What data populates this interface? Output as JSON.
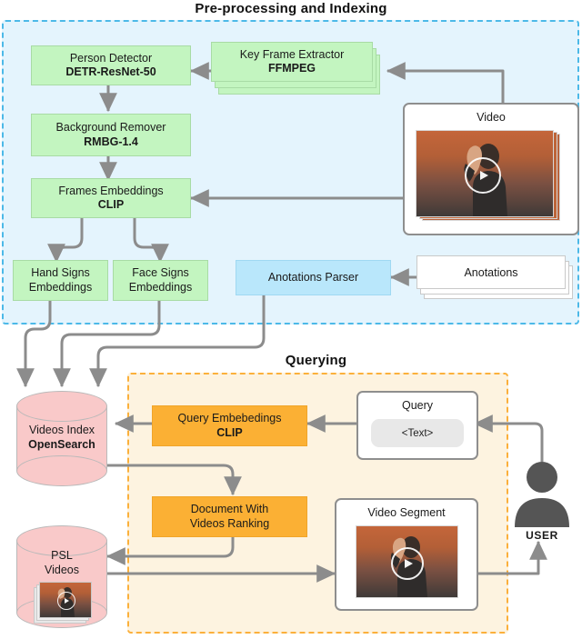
{
  "diagram": {
    "sections": {
      "preprocessing": {
        "title": "Pre-processing and Indexing",
        "accent": "#4cb9e8",
        "fill": "#e4f4fd"
      },
      "querying": {
        "title": "Querying",
        "accent": "#fbb03b",
        "fill": "#fdf3e0"
      }
    },
    "nodes": {
      "person_detector": {
        "title": "Person Detector",
        "model": "DETR-ResNet-50",
        "color": "#c3f5c0"
      },
      "key_frame": {
        "title": "Key Frame Extractor",
        "model": "FFMPEG",
        "color": "#c3f5c0"
      },
      "background_remover": {
        "title": "Background Remover",
        "model": "RMBG-1.4",
        "color": "#c3f5c0"
      },
      "frames_embeddings": {
        "title": "Frames Embeddings",
        "model": "CLIP",
        "color": "#c3f5c0"
      },
      "hand_signs": {
        "line1": "Hand Signs",
        "line2": "Embeddings",
        "color": "#c3f5c0"
      },
      "face_signs": {
        "line1": "Face Signs",
        "line2": "Embeddings",
        "color": "#c3f5c0"
      },
      "anotations_parser": {
        "title": "Anotations Parser",
        "color": "#b9e7fb"
      },
      "anotations": {
        "title": "Anotations",
        "color": "#ffffff"
      },
      "video": {
        "title": "Video",
        "color": "#ffffff"
      },
      "videos_index": {
        "line1": "Videos Index",
        "line2": "OpenSearch",
        "color": "#f9c9c9"
      },
      "psl_videos": {
        "line1": "PSL",
        "line2": "Videos",
        "color": "#f9c9c9"
      },
      "query_embeddings": {
        "title": "Query Embebedings",
        "model": "CLIP",
        "color": "#fbb034"
      },
      "document_ranking": {
        "line1": "Document With",
        "line2": "Videos Ranking",
        "color": "#fbb034"
      },
      "query": {
        "title": "Query",
        "value": "<Text>",
        "color": "#ffffff"
      },
      "video_segment": {
        "title": "Video Segment",
        "color": "#ffffff"
      },
      "user": {
        "label": "USER",
        "color": "#555555"
      }
    },
    "icons": {
      "play": "play-icon",
      "user": "user-icon",
      "database": "database-cylinder-icon"
    },
    "edges": [
      {
        "from": "video",
        "to": "key_frame"
      },
      {
        "from": "key_frame",
        "to": "person_detector"
      },
      {
        "from": "person_detector",
        "to": "background_remover"
      },
      {
        "from": "background_remover",
        "to": "frames_embeddings"
      },
      {
        "from": "video",
        "to": "frames_embeddings"
      },
      {
        "from": "frames_embeddings",
        "to": "hand_signs"
      },
      {
        "from": "frames_embeddings",
        "to": "face_signs"
      },
      {
        "from": "anotations",
        "to": "anotations_parser"
      },
      {
        "from": "hand_signs",
        "to": "videos_index"
      },
      {
        "from": "face_signs",
        "to": "videos_index"
      },
      {
        "from": "anotations_parser",
        "to": "videos_index"
      },
      {
        "from": "user",
        "to": "query"
      },
      {
        "from": "query",
        "to": "query_embeddings"
      },
      {
        "from": "query_embeddings",
        "to": "videos_index"
      },
      {
        "from": "videos_index",
        "to": "document_ranking"
      },
      {
        "from": "document_ranking",
        "to": "psl_videos"
      },
      {
        "from": "psl_videos",
        "to": "video_segment"
      },
      {
        "from": "video_segment",
        "to": "user"
      }
    ],
    "wire_color": "#8c8c8c"
  }
}
